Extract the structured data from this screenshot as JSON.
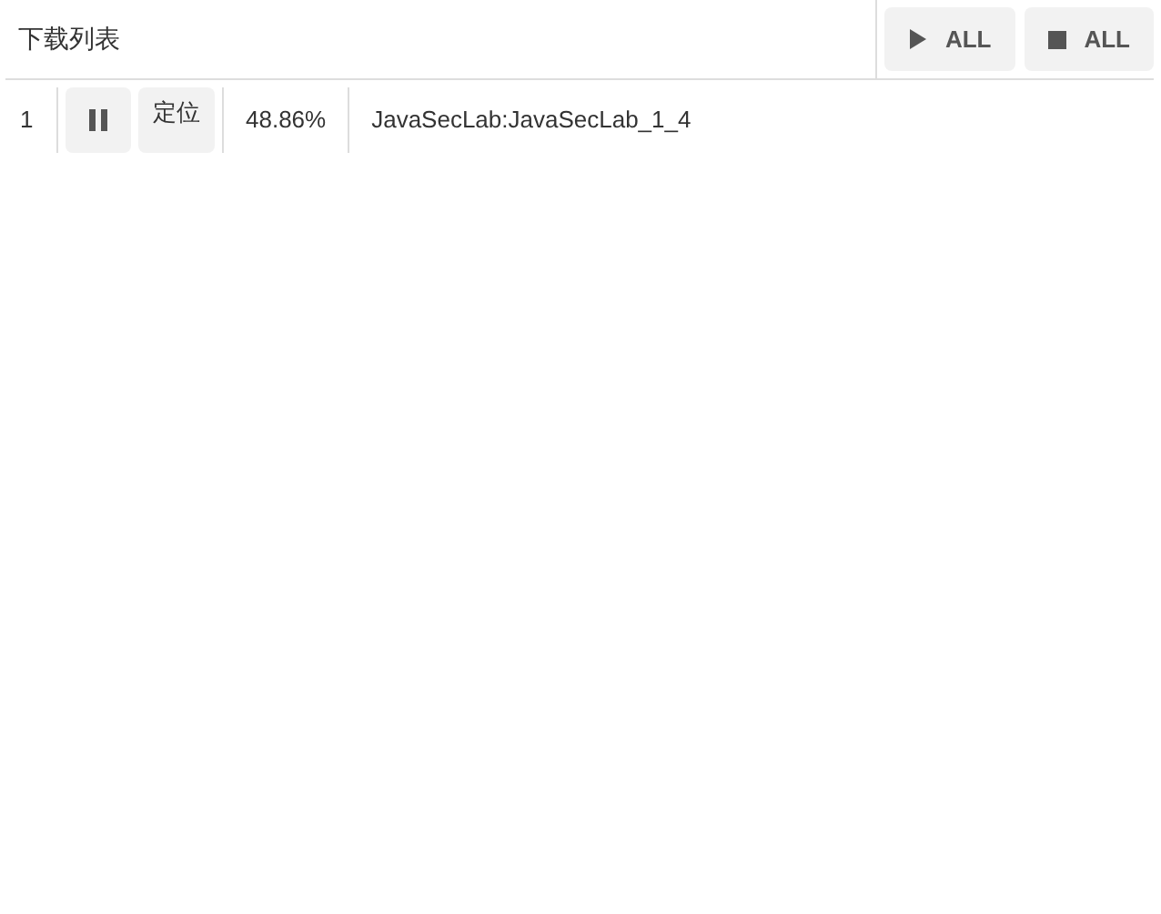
{
  "title": "下载列表",
  "toolbar": [
    {
      "kind": "start",
      "label": "ALL"
    },
    {
      "kind": "stop",
      "label": "ALL"
    }
  ],
  "rows": [
    {
      "index": "1",
      "downloading": true,
      "locate": "定位",
      "progress": "48.86%",
      "name": "JavaSecLab:JavaSecLab_1_4"
    }
  ]
}
